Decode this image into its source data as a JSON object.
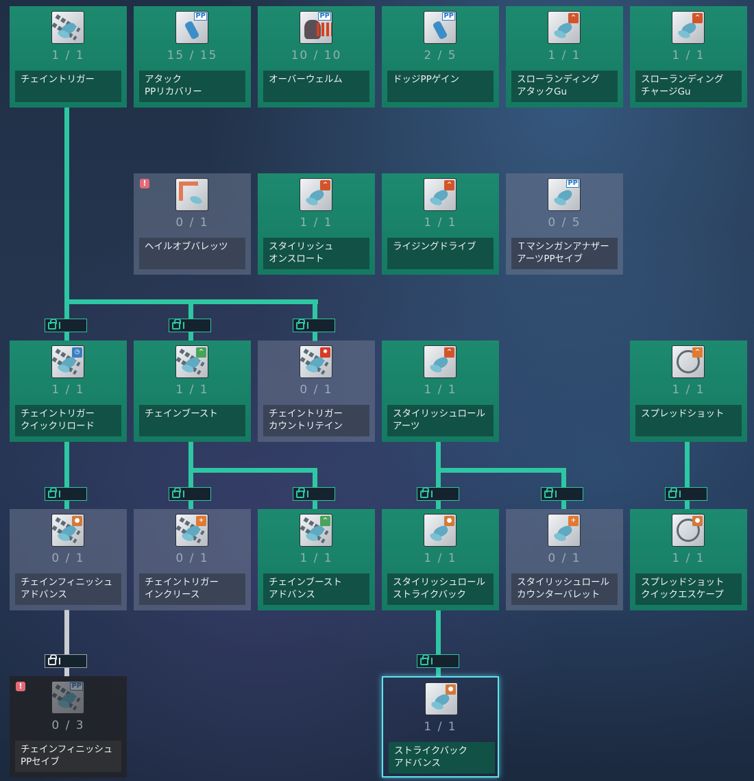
{
  "lock_label": "I",
  "warn_glyph": "!",
  "colors": {
    "learned": "#1d8a6f",
    "line": "#2ec7a3",
    "locked_line": "#c9ccd2",
    "selected_border": "#5ee4ee"
  },
  "skills": [
    {
      "id": "r1c1",
      "name": "チェイントリガー",
      "count": "1 / 1",
      "status": "learned",
      "icon": "chain-figure-icon"
    },
    {
      "id": "r1c2",
      "name": "アタック\nPPリカバリー",
      "count": "15 / 15",
      "status": "learned",
      "icon": "kick-pp-icon"
    },
    {
      "id": "r1c3",
      "name": "オーバーウェルム",
      "count": "10 / 10",
      "status": "learned",
      "icon": "overwhelm-pp-icon"
    },
    {
      "id": "r1c4",
      "name": "ドッジPPゲイン",
      "count": "2 / 5",
      "status": "learned",
      "icon": "dodge-pp-icon"
    },
    {
      "id": "r1c5",
      "name": "スローランディング\nアタックGu",
      "count": "1 / 1",
      "status": "learned",
      "icon": "slow-landing-attack-icon"
    },
    {
      "id": "r1c6",
      "name": "スローランディング\nチャージGu",
      "count": "1 / 1",
      "status": "learned",
      "icon": "slow-landing-charge-icon"
    },
    {
      "id": "r2c2",
      "name": "ヘイルオブバレッツ",
      "count": "0 / 1",
      "status": "unlearned",
      "icon": "hail-of-bullets-icon",
      "warn": true
    },
    {
      "id": "r2c3",
      "name": "スタイリッシュ\nオンスロート",
      "count": "1 / 1",
      "status": "learned",
      "icon": "stylish-onslaught-icon"
    },
    {
      "id": "r2c4",
      "name": "ライジングドライブ",
      "count": "1 / 1",
      "status": "learned",
      "icon": "rising-drive-icon"
    },
    {
      "id": "r2c5",
      "name": "Ｔマシンガンアナザー\nアーツPPセイブ",
      "count": "0 / 5",
      "status": "unlearned",
      "icon": "arts-pp-save-icon"
    },
    {
      "id": "r3c1",
      "name": "チェイントリガー\nクイックリロード",
      "count": "1 / 1",
      "status": "learned",
      "icon": "chain-quick-reload-icon"
    },
    {
      "id": "r3c2",
      "name": "チェインブースト",
      "count": "1 / 1",
      "status": "learned",
      "icon": "chain-boost-icon"
    },
    {
      "id": "r3c3",
      "name": "チェイントリガー\nカウントリテイン",
      "count": "0 / 1",
      "status": "unlearned",
      "icon": "chain-count-retain-icon"
    },
    {
      "id": "r3c4",
      "name": "スタイリッシュロール\nアーツ",
      "count": "1 / 1",
      "status": "learned",
      "icon": "stylish-roll-arts-icon"
    },
    {
      "id": "r3c6",
      "name": "スプレッドショット",
      "count": "1 / 1",
      "status": "learned",
      "icon": "spread-shot-icon"
    },
    {
      "id": "r4c1",
      "name": "チェインフィニッシュ\nアドバンス",
      "count": "0 / 1",
      "status": "unlearned",
      "icon": "chain-finish-advance-icon"
    },
    {
      "id": "r4c2",
      "name": "チェイントリガー\nインクリース",
      "count": "0 / 1",
      "status": "unlearned",
      "icon": "chain-increase-icon"
    },
    {
      "id": "r4c3",
      "name": "チェインブースト\nアドバンス",
      "count": "1 / 1",
      "status": "learned",
      "icon": "chain-boost-advance-icon"
    },
    {
      "id": "r4c4",
      "name": "スタイリッシュロール\nストライクバック",
      "count": "1 / 1",
      "status": "learned",
      "icon": "strike-back-icon"
    },
    {
      "id": "r4c5",
      "name": "スタイリッシュロール\nカウンターバレット",
      "count": "0 / 1",
      "status": "unlearned",
      "icon": "counter-bullet-icon"
    },
    {
      "id": "r4c6",
      "name": "スプレッドショット\nクイックエスケープ",
      "count": "1 / 1",
      "status": "learned",
      "icon": "quick-escape-icon"
    },
    {
      "id": "r5c1",
      "name": "チェインフィニッシュ\nPPセイブ",
      "count": "0 / 3",
      "status": "dark",
      "icon": "chain-finish-pp-save-icon",
      "warn": true
    },
    {
      "id": "r5c4",
      "name": "ストライクバック\nアドバンス",
      "count": "1 / 1",
      "status": "selected",
      "icon": "strike-back-advance-icon"
    }
  ]
}
